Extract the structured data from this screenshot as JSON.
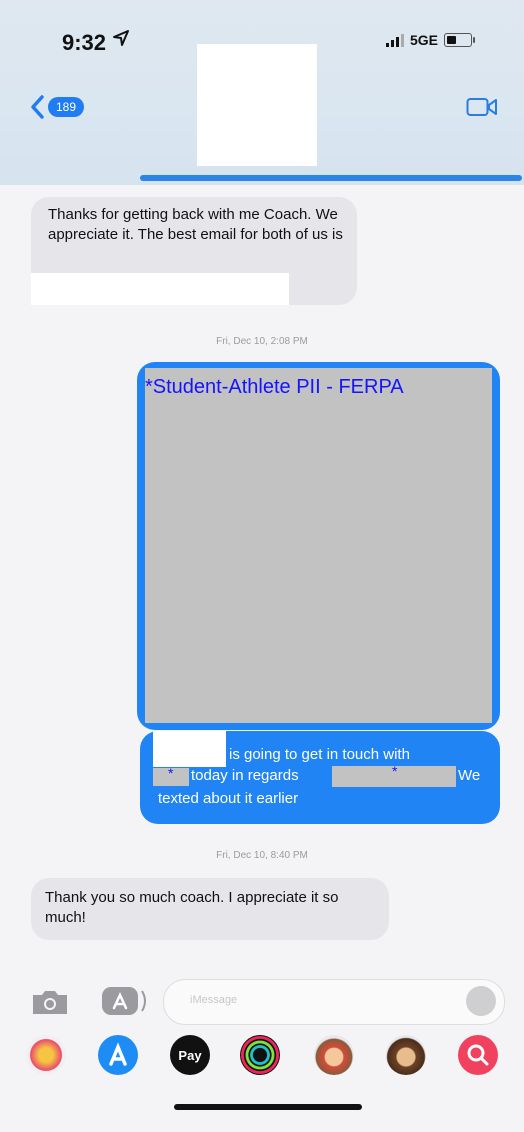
{
  "status": {
    "time": "9:32",
    "network": "5GE"
  },
  "header": {
    "back_badge": "189"
  },
  "messages": {
    "incoming_1": "Thanks for getting back with me Coach. We appreciate it. The best email for both of us is",
    "timestamp_1": "Fri, Dec 10, 2:08 PM",
    "ferpa_label": "*Student-Athlete PII - FERPA",
    "outgoing_part1": "is going to get in touch with",
    "outgoing_part2": "today in regards",
    "outgoing_part3": "We",
    "outgoing_part4": "texted about it earlier",
    "star": "*",
    "timestamp_2": "Fri, Dec 10, 8:40 PM",
    "incoming_2": "Thank you so much coach. I appreciate it so much!"
  },
  "input": {
    "placeholder": "iMessage"
  },
  "apps": [
    {
      "name": "photos-app-icon"
    },
    {
      "name": "app-store-icon"
    },
    {
      "name": "apple-pay-icon",
      "label": "Pay"
    },
    {
      "name": "activity-icon"
    },
    {
      "name": "memoji-icon-1"
    },
    {
      "name": "memoji-icon-2"
    },
    {
      "name": "search-images-icon"
    }
  ],
  "colors": {
    "blue": "#2084f4",
    "gray_bubble": "#e6e5ea",
    "ferpa_blue": "#1414ff"
  }
}
